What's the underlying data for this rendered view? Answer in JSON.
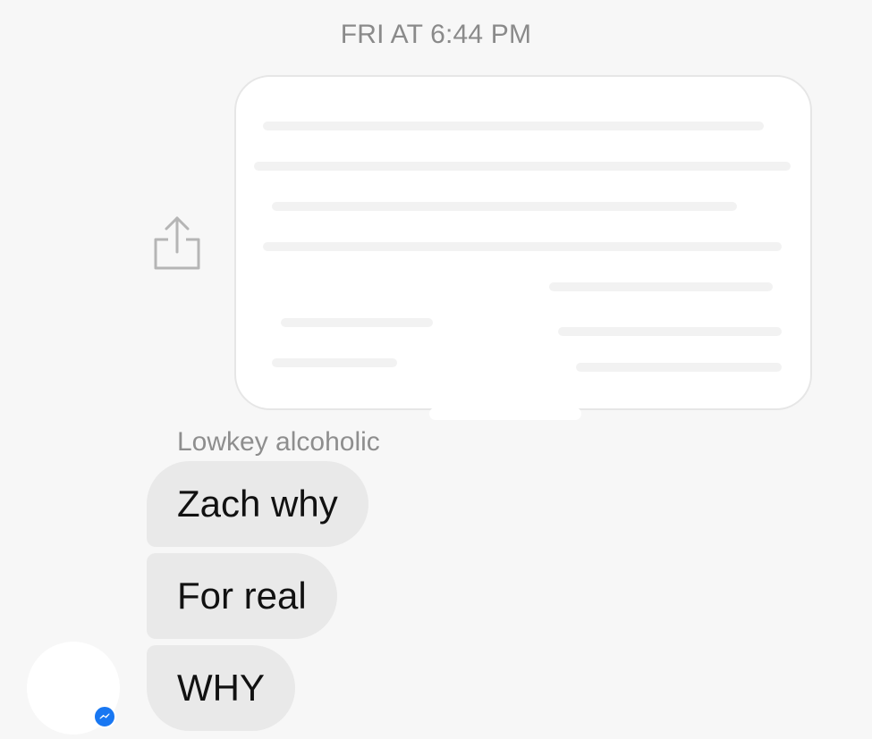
{
  "header": {
    "timestamp": "FRI AT 6:44 PM"
  },
  "shared_attachment": {
    "share_icon": "share-upload-icon",
    "content": "blurred/redacted preview"
  },
  "sender": {
    "name": "Lowkey alcoholic",
    "avatar_badge_icon": "messenger-icon",
    "badge_color": "#1877f2"
  },
  "messages": [
    {
      "text": "Zach why"
    },
    {
      "text": "For real"
    },
    {
      "text": "WHY"
    }
  ],
  "colors": {
    "background": "#f7f7f7",
    "bubble": "#e9e9e9",
    "muted_text": "#8a8a8a"
  }
}
